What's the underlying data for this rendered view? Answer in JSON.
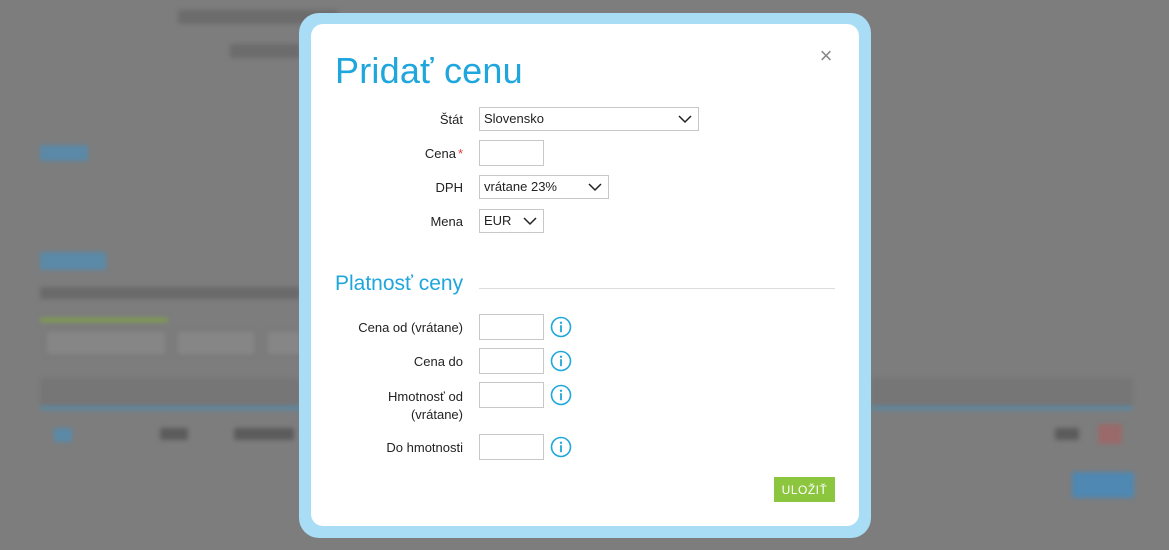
{
  "dialog": {
    "title": "Pridať cenu",
    "close_symbol": "×",
    "fields": {
      "state": {
        "label": "Štát",
        "value": "Slovensko"
      },
      "price": {
        "label": "Cena",
        "required_mark": "*",
        "value": ""
      },
      "vat": {
        "label": "DPH",
        "value": "vrátane 23%"
      },
      "currency": {
        "label": "Mena",
        "value": "EUR"
      }
    },
    "validity_section": {
      "title": "Platnosť ceny",
      "fields": {
        "price_from": {
          "label": "Cena od (vrátane)",
          "value": "",
          "icon": "info-icon"
        },
        "price_to": {
          "label": "Cena do",
          "value": "",
          "icon": "info-icon"
        },
        "weight_from_line1": "Hmotnosť od",
        "weight_from_line2": "(vrátane)",
        "weight_from": {
          "value": "",
          "icon": "info-icon"
        },
        "weight_to": {
          "label": "Do hmotnosti",
          "value": "",
          "icon": "info-icon"
        }
      }
    },
    "save_label": "ULOŽIŤ"
  },
  "colors": {
    "accent": "#1fa6dc",
    "frame": "#a8ddf5",
    "save": "#8cc63f",
    "required": "#e23a3a",
    "backdrop": "#7d7d7d"
  }
}
